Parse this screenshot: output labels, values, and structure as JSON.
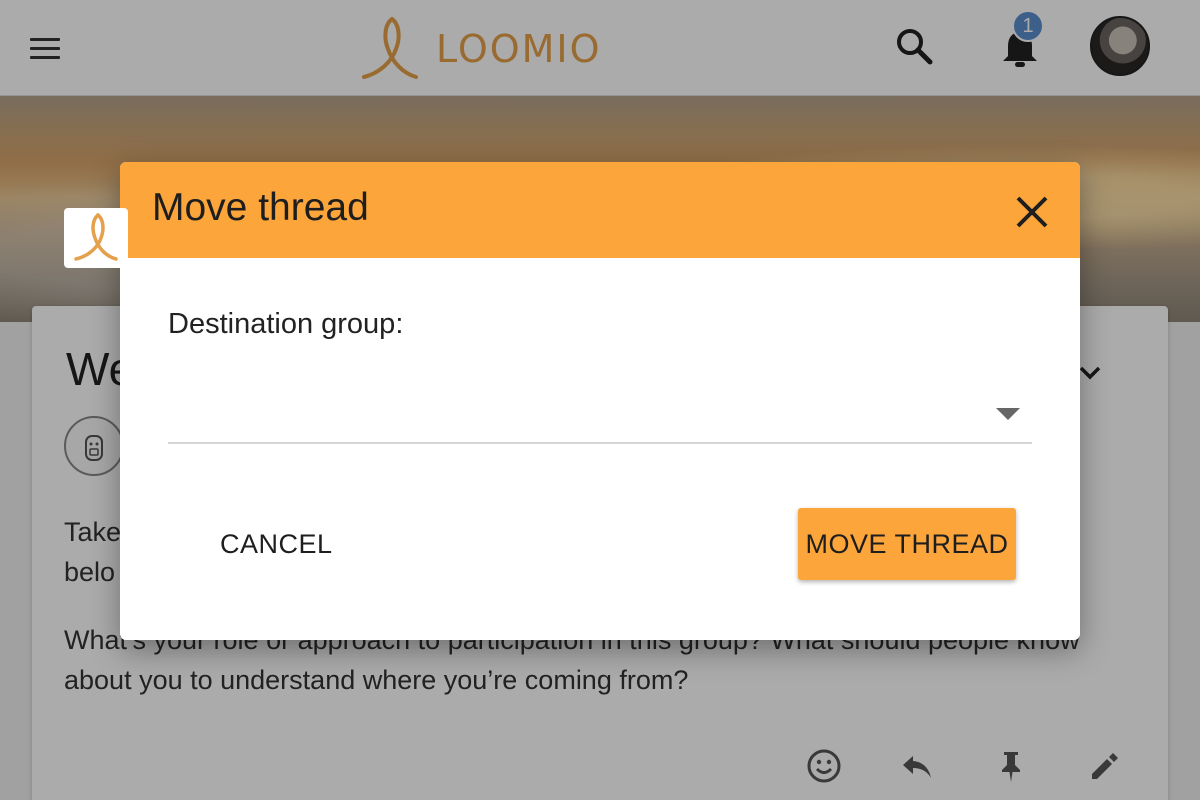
{
  "app": {
    "brand_name": "LOOMIO",
    "notification_count": "1",
    "colors": {
      "brand": "#e4a04a",
      "accent": "#fca53a",
      "badge": "#5b8fd0"
    }
  },
  "background_card": {
    "title": "We",
    "paragraph1": "Take\nbelo",
    "paragraph2": "What’s your role or approach to participation in this group? What should people know about you to understand where you’re coming from?"
  },
  "dialog": {
    "title": "Move thread",
    "field_label": "Destination group:",
    "select_value": "",
    "cancel_label": "CANCEL",
    "submit_label": "MOVE THREAD"
  },
  "icons": [
    "menu-icon",
    "loomio-logo-icon",
    "search-icon",
    "bell-icon",
    "close-icon",
    "chevron-down-icon",
    "emoji-icon",
    "reply-icon",
    "pin-icon",
    "edit-icon"
  ]
}
